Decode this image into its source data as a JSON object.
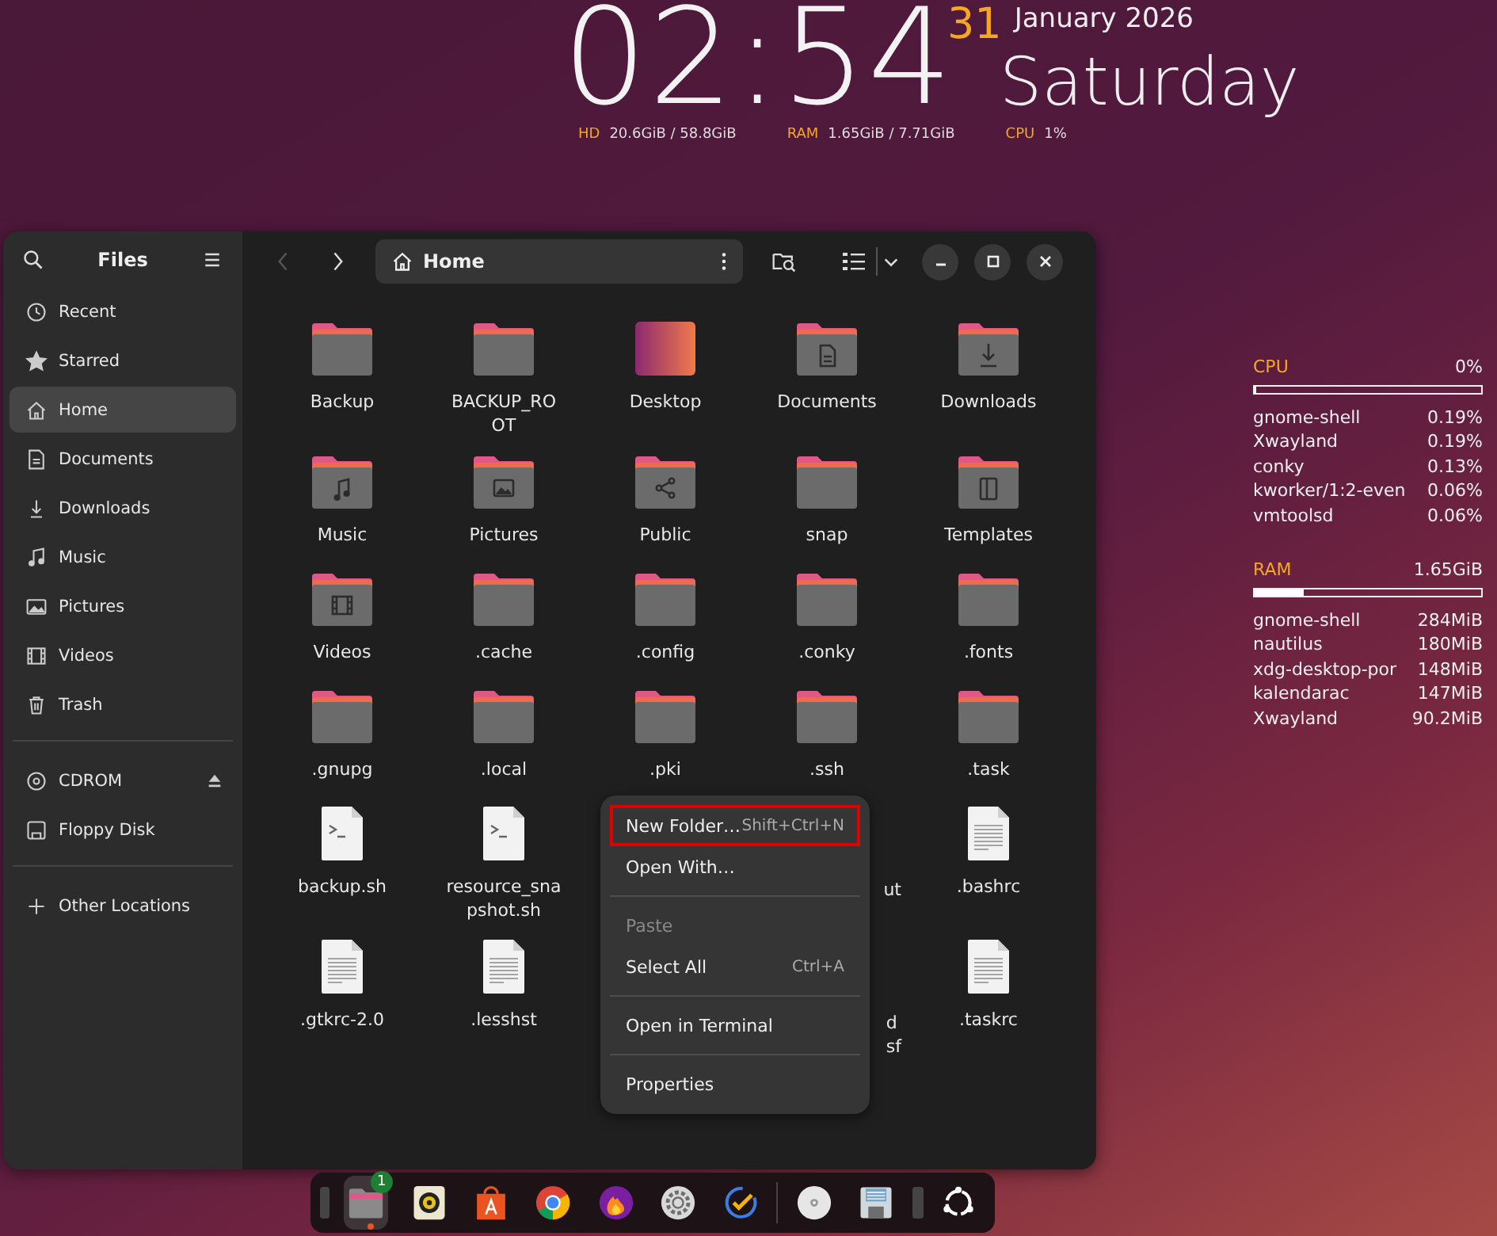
{
  "clock": {
    "time": "02:54",
    "day_number": "31",
    "month_year": "January 2026",
    "weekday": "Saturday",
    "stats": [
      {
        "label": "HD",
        "value": "20.6GiB / 58.8GiB"
      },
      {
        "label": "RAM",
        "value": "1.65GiB / 7.71GiB"
      },
      {
        "label": "CPU",
        "value": "1%"
      }
    ]
  },
  "window": {
    "title": "Files",
    "path": "Home",
    "back_disabled": true,
    "sidebar": {
      "items": [
        {
          "kind": "recent",
          "label": "Recent",
          "selected": false
        },
        {
          "kind": "starred",
          "label": "Starred",
          "selected": false
        },
        {
          "kind": "home",
          "label": "Home",
          "selected": true
        },
        {
          "kind": "documents",
          "label": "Documents",
          "selected": false
        },
        {
          "kind": "downloads",
          "label": "Downloads",
          "selected": false
        },
        {
          "kind": "music",
          "label": "Music",
          "selected": false
        },
        {
          "kind": "pictures",
          "label": "Pictures",
          "selected": false
        },
        {
          "kind": "videos",
          "label": "Videos",
          "selected": false
        },
        {
          "kind": "trash",
          "label": "Trash",
          "selected": false
        },
        {
          "kind": "separator"
        },
        {
          "kind": "cdrom",
          "label": "CDROM",
          "selected": false
        },
        {
          "kind": "floppy",
          "label": "Floppy Disk",
          "selected": false
        },
        {
          "kind": "separator"
        },
        {
          "kind": "other",
          "label": "Other Locations",
          "selected": false
        }
      ]
    },
    "files": [
      {
        "kind": "folder",
        "label": "Backup"
      },
      {
        "kind": "folder",
        "label": "BACKUP_RO\nOT"
      },
      {
        "kind": "desktop",
        "label": "Desktop"
      },
      {
        "kind": "documents",
        "label": "Documents"
      },
      {
        "kind": "downloads",
        "label": "Downloads"
      },
      {
        "kind": "music",
        "label": "Music"
      },
      {
        "kind": "pictures",
        "label": "Pictures"
      },
      {
        "kind": "public",
        "label": "Public"
      },
      {
        "kind": "folder",
        "label": "snap"
      },
      {
        "kind": "templates",
        "label": "Templates"
      },
      {
        "kind": "videos",
        "label": "Videos"
      },
      {
        "kind": "folder",
        "label": ".cache"
      },
      {
        "kind": "folder",
        "label": ".config"
      },
      {
        "kind": "folder",
        "label": ".conky"
      },
      {
        "kind": "folder",
        "label": ".fonts"
      },
      {
        "kind": "folder",
        "label": ".gnupg"
      },
      {
        "kind": "folder",
        "label": ".local"
      },
      {
        "kind": "folder",
        "label": ".pki"
      },
      {
        "kind": "folder",
        "label": ".ssh"
      },
      {
        "kind": "folder",
        "label": ".task"
      },
      {
        "kind": "script",
        "label": "backup.sh"
      },
      {
        "kind": "script",
        "label": "resource_sna\npshot.sh"
      },
      {
        "kind": "partial",
        "label": "ut"
      },
      {
        "kind": "text",
        "label": ".bashrc"
      },
      {
        "kind": "text",
        "label": ".gtkrc-2.0"
      },
      {
        "kind": "text",
        "label": ".lesshst"
      },
      {
        "kind": "partial",
        "label": "d\nsf"
      },
      {
        "kind": "text",
        "label": ".taskrc"
      }
    ],
    "context_menu": [
      {
        "kind": "item",
        "label": "New Folder…",
        "shortcut": "Shift+Ctrl+N",
        "disabled": false,
        "highlighted": true
      },
      {
        "kind": "item",
        "label": "Open With…",
        "disabled": false,
        "highlighted": false
      },
      {
        "kind": "separator"
      },
      {
        "kind": "item",
        "label": "Paste",
        "disabled": true,
        "highlighted": false
      },
      {
        "kind": "item",
        "label": "Select All",
        "shortcut": "Ctrl+A",
        "disabled": false,
        "highlighted": false
      },
      {
        "kind": "separator"
      },
      {
        "kind": "item",
        "label": "Open in Terminal",
        "disabled": false,
        "highlighted": false
      },
      {
        "kind": "separator"
      },
      {
        "kind": "item",
        "label": "Properties",
        "disabled": false,
        "highlighted": false
      }
    ]
  },
  "conky": {
    "cpu": {
      "label": "CPU",
      "value": "0%",
      "level": 0,
      "processes": [
        {
          "name": "gnome-shell",
          "value": "0.19%"
        },
        {
          "name": "Xwayland",
          "value": "0.19%"
        },
        {
          "name": "conky",
          "value": "0.13%"
        },
        {
          "name": "kworker/1:2-even",
          "value": "0.06%"
        },
        {
          "name": "vmtoolsd",
          "value": "0.06%"
        }
      ]
    },
    "ram": {
      "label": "RAM",
      "value": "1.65GiB",
      "level": 0.21,
      "processes": [
        {
          "name": "gnome-shell",
          "value": "284MiB"
        },
        {
          "name": "nautilus",
          "value": "180MiB"
        },
        {
          "name": "xdg-desktop-por",
          "value": "148MiB"
        },
        {
          "name": "kalendarac",
          "value": "147MiB"
        },
        {
          "name": "Xwayland",
          "value": "90.2MiB"
        }
      ]
    }
  },
  "dock": [
    {
      "kind": "partial"
    },
    {
      "kind": "files",
      "running": true,
      "selected": true,
      "badge": "1"
    },
    {
      "kind": "rhythmbox",
      "running": false,
      "selected": false
    },
    {
      "kind": "store",
      "running": false,
      "selected": false
    },
    {
      "kind": "chrome",
      "running": false,
      "selected": false
    },
    {
      "kind": "firefox",
      "running": false,
      "selected": false
    },
    {
      "kind": "settings",
      "running": false,
      "selected": false
    },
    {
      "kind": "tasks",
      "running": false,
      "selected": false
    },
    {
      "kind": "separator"
    },
    {
      "kind": "disc",
      "running": false,
      "selected": false
    },
    {
      "kind": "floppy",
      "running": false,
      "selected": false
    },
    {
      "kind": "partial"
    },
    {
      "kind": "apps",
      "running": false,
      "selected": false
    }
  ]
}
